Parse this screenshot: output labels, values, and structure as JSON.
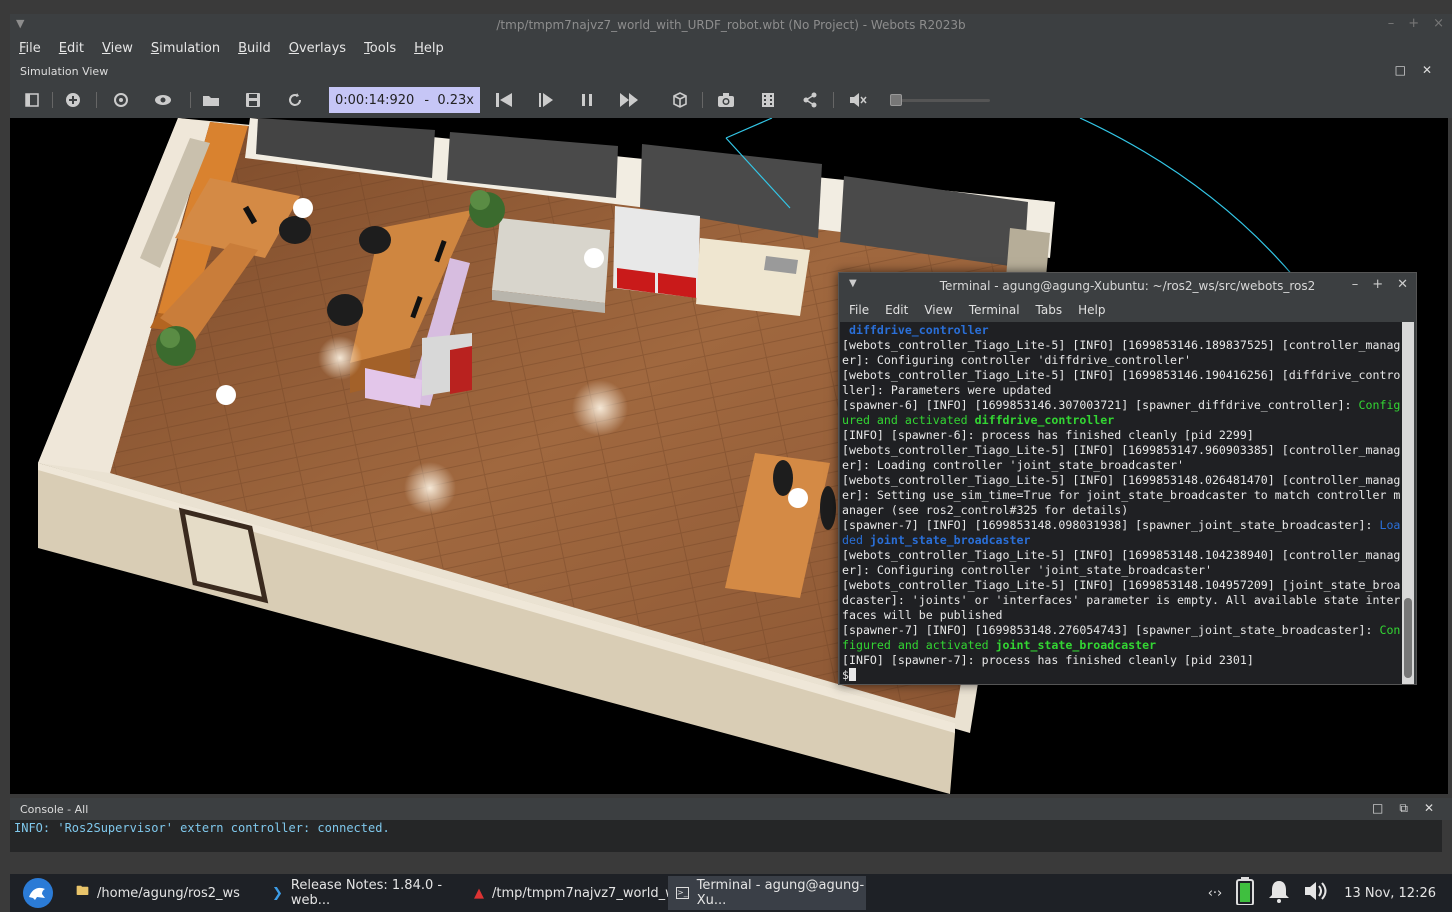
{
  "window": {
    "title": "/tmp/tmpm7najvz7_world_with_URDF_robot.wbt (No Project) - Webots R2023b",
    "controls": [
      "–",
      "+",
      "×"
    ]
  },
  "menubar": {
    "items": [
      "File",
      "Edit",
      "View",
      "Simulation",
      "Build",
      "Overlays",
      "Tools",
      "Help"
    ]
  },
  "simulation_view": {
    "title": "Simulation View",
    "time": "0:00:14:920",
    "time_separator": "-",
    "speed": "0.23x"
  },
  "terminal": {
    "title": "Terminal - agung@agung-Xubuntu: ~/ros2_ws/src/webots_ros2",
    "menu": [
      "File",
      "Edit",
      "View",
      "Terminal",
      "Tabs",
      "Help"
    ],
    "lines": {
      "l0": " diffdrive_controller",
      "l1": "[webots_controller_Tiago_Lite-5] [INFO] [1699853146.189837525] [controller_manag",
      "l2": "er]: Configuring controller 'diffdrive_controller'",
      "l3": "[webots_controller_Tiago_Lite-5] [INFO] [1699853146.190416256] [diffdrive_contro",
      "l4": "ller]: Parameters were updated",
      "l5a": "[spawner-6] [INFO] [1699853146.307003721] [spawner_diffdrive_controller]: ",
      "l5b": "Config",
      "l6a": "ured and activated ",
      "l6b": "diffdrive_controller",
      "l7": "[INFO] [spawner-6]: process has finished cleanly [pid 2299]",
      "l8": "[webots_controller_Tiago_Lite-5] [INFO] [1699853147.960903385] [controller_manag",
      "l9": "er]: Loading controller 'joint_state_broadcaster'",
      "l10": "[webots_controller_Tiago_Lite-5] [INFO] [1699853148.026481470] [controller_manag",
      "l11": "er]: Setting use_sim_time=True for joint_state_broadcaster to match controller m",
      "l12": "anager (see ros2_control#325 for details)",
      "l13a": "[spawner-7] [INFO] [1699853148.098031938] [spawner_joint_state_broadcaster]: ",
      "l13b": "Loa",
      "l14a": "ded ",
      "l14b": "joint_state_broadcaster",
      "l15": "[webots_controller_Tiago_Lite-5] [INFO] [1699853148.104238940] [controller_manag",
      "l16": "er]: Configuring controller 'joint_state_broadcaster'",
      "l17": "[webots_controller_Tiago_Lite-5] [INFO] [1699853148.104957209] [joint_state_broa",
      "l18": "dcaster]: 'joints' or 'interfaces' parameter is empty. All available state inter",
      "l19": "faces will be published",
      "l20a": "[spawner-7] [INFO] [1699853148.276054743] [spawner_joint_state_broadcaster]: ",
      "l20b": "Con",
      "l21a": "figured and activated ",
      "l21b": "joint_state_broadcaster",
      "l22": "[INFO] [spawner-7]: process has finished cleanly [pid 2301]",
      "l23": "$"
    }
  },
  "console": {
    "title": "Console - All",
    "line": "INFO: 'Ros2Supervisor' extern controller: connected."
  },
  "taskbar": {
    "items": [
      {
        "label": "/home/agung/ros2_ws",
        "icon": "folder-icon"
      },
      {
        "label": "Release Notes: 1.84.0 - web...",
        "icon": "vscode-icon"
      },
      {
        "label": "/tmp/tmpm7najvz7_world_w...",
        "icon": "webots-icon"
      },
      {
        "label": "Terminal - agung@agung-Xu...",
        "icon": "terminal-icon"
      }
    ],
    "network": "‹·›",
    "clock": "13 Nov, 12:26"
  },
  "colors": {
    "chrome": "#3c3f41",
    "time_box": "#c6c6f6",
    "terminal_bg": "#1f2023",
    "terminal_blue": "#2a6fd8",
    "terminal_green": "#33d633",
    "console_text": "#7fc8ec",
    "floor": "#a0683f"
  }
}
